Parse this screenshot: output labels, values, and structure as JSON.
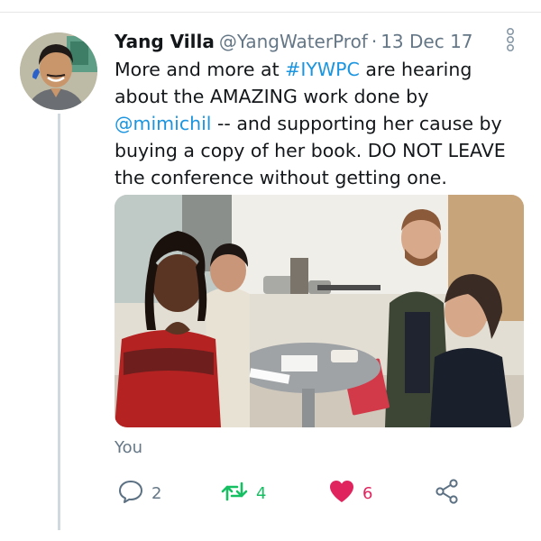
{
  "tweet": {
    "author": {
      "display_name": "Yang Villa",
      "handle": "@YangWaterProf"
    },
    "separator": "·",
    "date": "13 Dec 17",
    "text": {
      "p1": "More and more at ",
      "hashtag": "#IYWPC",
      "p2": " are hearing about the AMAZING work done by ",
      "mention": "@mimichil",
      "p3": " -- and supporting her cause by buying a copy of her book. DO NOT LEAVE the conference without getting one."
    },
    "context_label": "You",
    "actions": {
      "replies": "2",
      "retweets": "4",
      "likes": "6"
    }
  },
  "colors": {
    "text": "#14171a",
    "secondary": "#657786",
    "link": "#1b95e0",
    "retweet": "#17bf63",
    "like": "#e0245e",
    "thread_line": "#cfd9de"
  },
  "icons": {
    "overflow": "overflow-vertical-icon",
    "reply": "reply-icon",
    "retweet": "retweet-icon",
    "like": "heart-filled-icon",
    "share": "share-icon"
  }
}
